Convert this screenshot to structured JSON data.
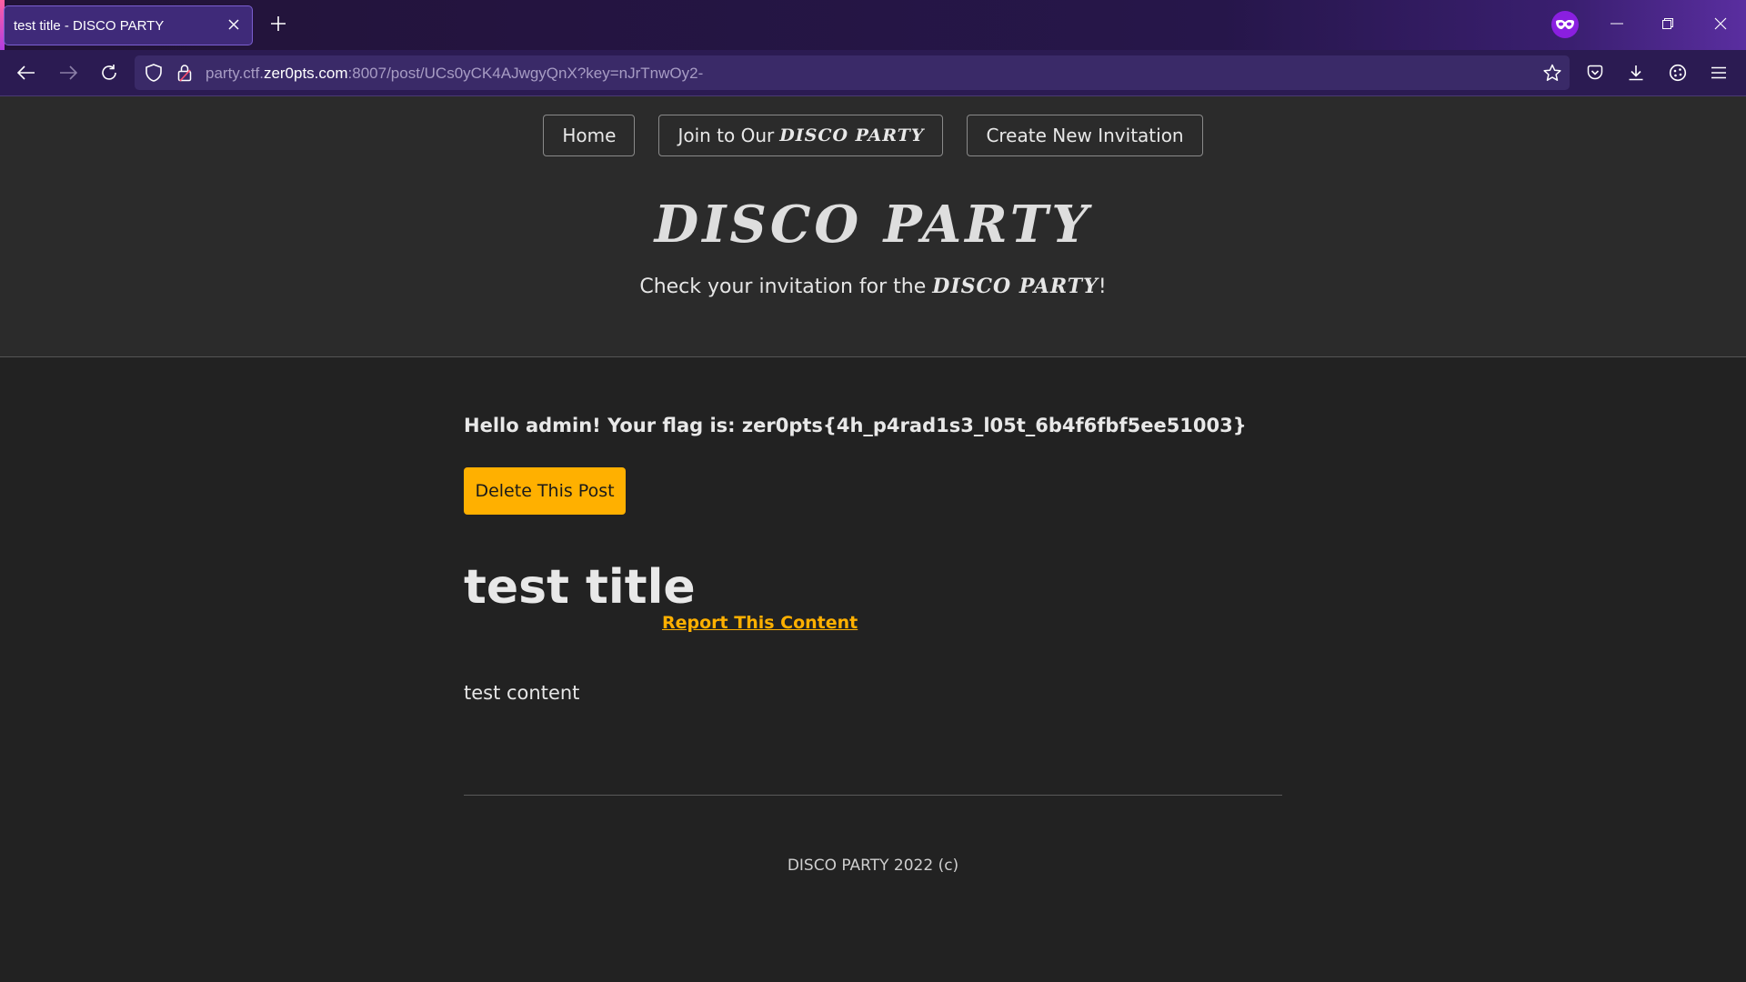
{
  "browser": {
    "tab": {
      "title": "test title - DISCO PARTY"
    },
    "url": {
      "prefix": "party.ctf.",
      "host": "zer0pts.com",
      "rest": ":8007/post/UCs0yCK4AJwgyQnX?key=nJrTnwOy2-"
    },
    "icons": {
      "back": "back-arrow-icon",
      "forward": "forward-arrow-icon",
      "reload": "reload-icon",
      "shield": "tracking-protection-shield-icon",
      "lock": "lock-icon",
      "bookmark": "star-bookmark-icon",
      "pocket": "pocket-icon",
      "downloads": "download-icon",
      "extensions": "extensions-icon",
      "menu": "hamburger-menu-icon",
      "private": "private-browsing-mask-icon"
    }
  },
  "nav": {
    "home": "Home",
    "join_prefix": "Join to Our",
    "join_brand": "DISCO PARTY",
    "create": "Create New Invitation"
  },
  "header": {
    "title": "DISCO PARTY",
    "subtitle_prefix": "Check your invitation for the",
    "subtitle_brand": "DISCO PARTY",
    "subtitle_suffix": "!"
  },
  "post": {
    "flag_message": "Hello admin! Your flag is: zer0pts{4h_p4rad1s3_l05t_6b4f6fbf5ee51003}",
    "delete_label": "Delete This Post",
    "title": "test title",
    "report_label": "Report This Content",
    "body": "test content"
  },
  "footer": {
    "text": "DISCO PARTY 2022 (c)"
  },
  "colors": {
    "accent": "#ffb000",
    "page_bg": "#222222",
    "header_bg": "#2b2b2b",
    "chrome_bg": "#2b1b52"
  }
}
